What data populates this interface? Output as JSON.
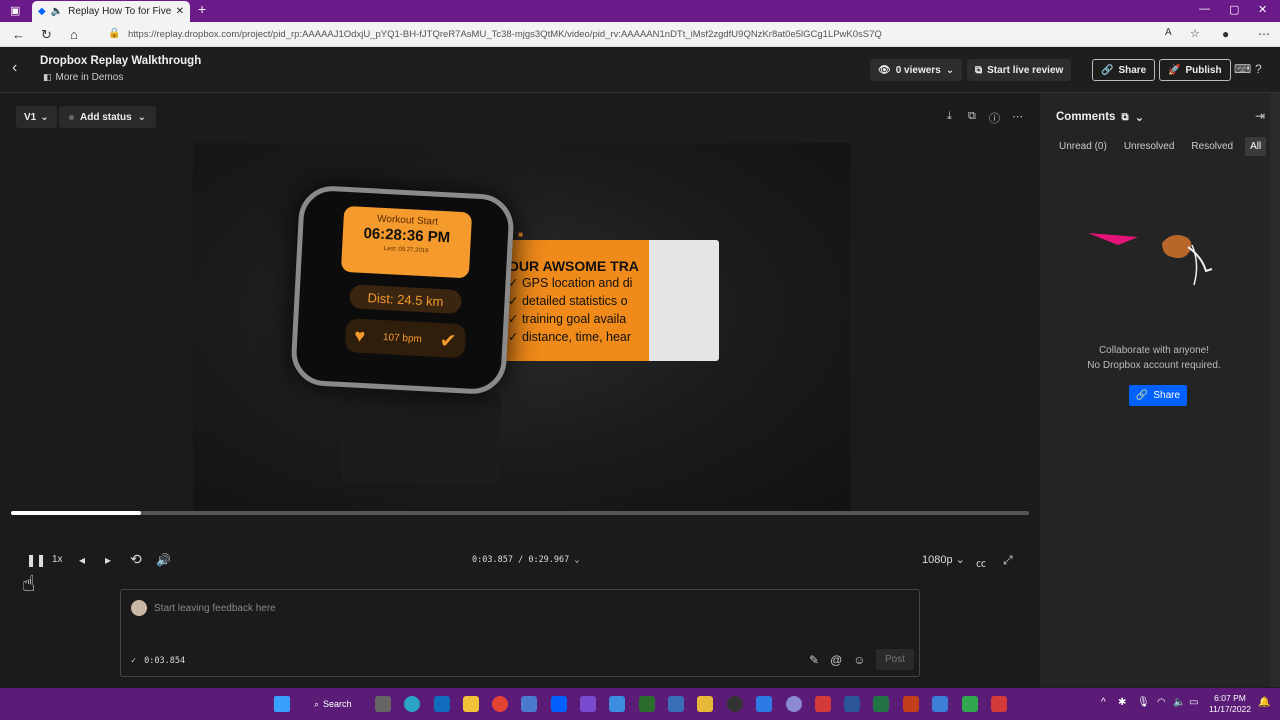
{
  "browser": {
    "tab_title": "Replay How To for Fiverr - I",
    "url": "https://replay.dropbox.com/project/pid_rp:AAAAAJ1OdxjU_pYQ1-BH-fJTQreR7AsMU_Tc38-mjgs3QtMK/video/pid_rv:AAAAAN1nDTt_iMsf2zgdfU9QNzKr8at0e5lGCg1LPwK0sS7Q"
  },
  "header": {
    "title": "Dropbox Replay Walkthrough",
    "folder": "More in Demos",
    "viewers": "0 viewers",
    "live_review": "Start live review",
    "share": "Share",
    "publish": "Publish"
  },
  "video_toolbar": {
    "version": "V1",
    "status": "Add status"
  },
  "video": {
    "workout_label": "Workout Start",
    "workout_time": "06:28:36 PM",
    "workout_date": "Last: 09.27.2019",
    "distance": "Dist: 24.5 km",
    "bpm": "107 bpm",
    "promo_heading": "OUR AWSOME TRA",
    "promo_items": [
      "✓ GPS location and di",
      "✓ detailed statistics o",
      "✓ training goal availa",
      "✓ distance, time, hear"
    ]
  },
  "player": {
    "progress": 0.128,
    "speed": "1x",
    "time_current": "0:03.857",
    "time_separator": "/",
    "time_total": "0:29.967",
    "quality": "1080p"
  },
  "feedback": {
    "placeholder": "Start leaving feedback here",
    "timestamp": "0:03.854",
    "post": "Post"
  },
  "comments": {
    "title": "Comments",
    "filters": [
      "Unread (0)",
      "Unresolved",
      "Resolved",
      "All"
    ],
    "active_filter": "All",
    "empty_line1": "Collaborate with anyone!",
    "empty_line2": "No Dropbox account required.",
    "share": "Share"
  },
  "taskbar": {
    "search": "Search",
    "time": "6:07 PM",
    "date": "11/17/2022"
  },
  "colors": {
    "tabbar": "#6b1a8a",
    "taskbar": "#5b1c78",
    "accent_blue": "#0061fe",
    "promo_orange": "#f08a1a"
  }
}
